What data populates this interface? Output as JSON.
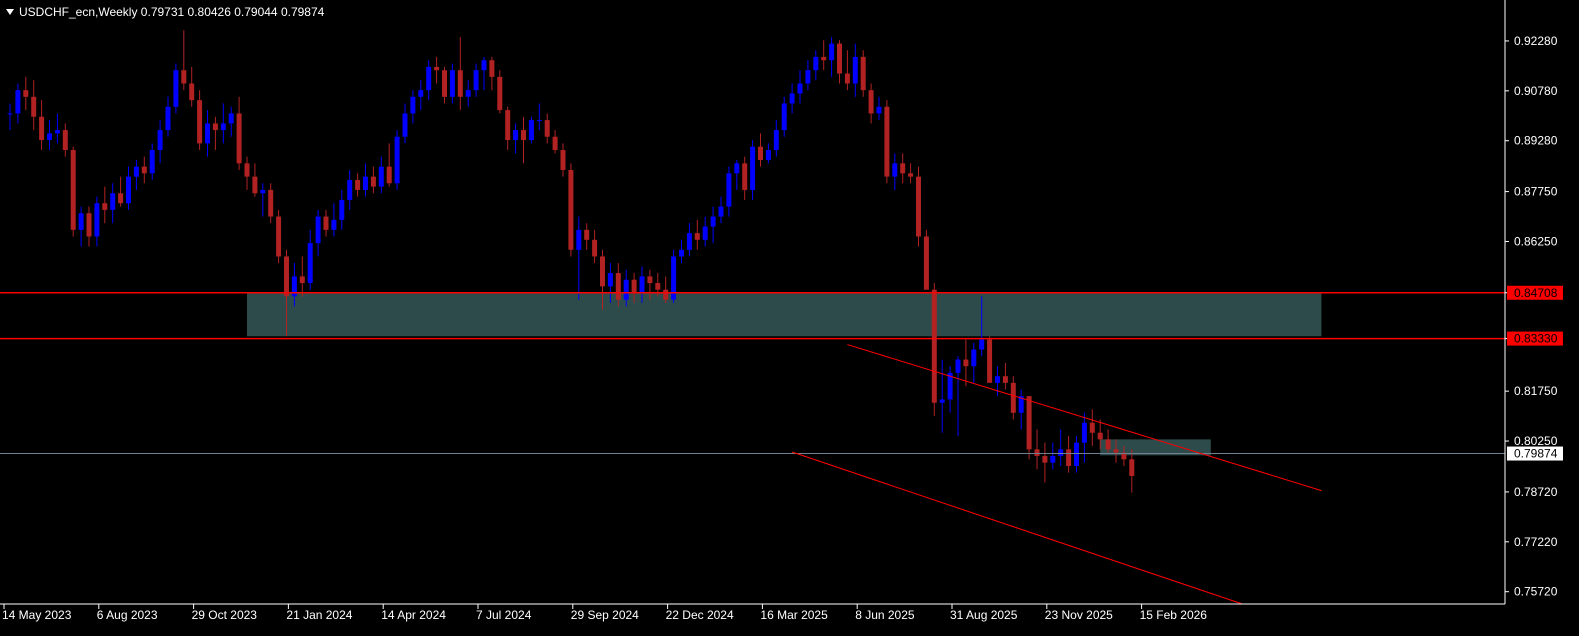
{
  "header": {
    "symbol": "USDCHF_ecn",
    "timeframe": "Weekly",
    "ohlc": "0.79731 0.80426 0.79044 0.79874",
    "title_text": "USDCHF_ecn,Weekly  0.79731 0.80426 0.79044 0.79874"
  },
  "colors": {
    "background": "#000000",
    "bull_candle": "#0000ff",
    "bear_candle": "#b22222",
    "zone_fill": "#2f4f4f",
    "level_line": "#ff0000",
    "channel_line": "#ff0000",
    "axis": "#ffffff",
    "price_line": "#708090"
  },
  "chart_data": {
    "type": "candlestick",
    "symbol": "USDCHF_ecn",
    "timeframe": "Weekly",
    "y_ticks": [
      "0.92280",
      "0.90780",
      "0.89280",
      "0.87750",
      "0.86250",
      "0.84708",
      "0.83330",
      "0.81750",
      "0.80250",
      "0.78720",
      "0.77220",
      "0.75720"
    ],
    "y_tick_values": [
      0.9228,
      0.9078,
      0.8928,
      0.8775,
      0.8625,
      0.84708,
      0.8333,
      0.8175,
      0.8025,
      0.7872,
      0.7722,
      0.7572
    ],
    "x_ticks": [
      "14 May 2023",
      "6 Aug 2023",
      "29 Oct 2023",
      "21 Jan 2024",
      "14 Apr 2024",
      "7 Jul 2024",
      "29 Sep 2024",
      "22 Dec 2024",
      "16 Mar 2025",
      "8 Jun 2025",
      "31 Aug 2025",
      "23 Nov 2025",
      "15 Feb 2026"
    ],
    "x_tick_index": [
      0,
      12,
      24,
      36,
      48,
      60,
      72,
      84,
      96,
      108,
      120,
      132,
      144
    ],
    "ylim": [
      0.7535,
      0.9315
    ],
    "current_price": "0.79874",
    "current_price_value": 0.79874,
    "horizontal_levels": [
      {
        "value": 0.84708,
        "label": "0.84708"
      },
      {
        "value": 0.8333,
        "label": "0.83330"
      }
    ],
    "zones": [
      {
        "from_index": 30,
        "to_index": 166,
        "top": 0.847,
        "bottom": 0.834
      },
      {
        "from_index": 138,
        "to_index": 152,
        "top": 0.803,
        "bottom": 0.7982
      }
    ],
    "channel": {
      "upper": {
        "from_index": 106,
        "from_price": 0.8315,
        "to_index": 166,
        "to_price": 0.7876
      },
      "lower": {
        "from_index": 99,
        "from_price": 0.7992,
        "to_index": 156,
        "to_price": 0.7535
      }
    },
    "candles": [
      {
        "o": 0.901,
        "h": 0.904,
        "l": 0.896,
        "c": 0.901
      },
      {
        "o": 0.901,
        "h": 0.91,
        "l": 0.898,
        "c": 0.908
      },
      {
        "o": 0.908,
        "h": 0.912,
        "l": 0.902,
        "c": 0.906
      },
      {
        "o": 0.906,
        "h": 0.911,
        "l": 0.896,
        "c": 0.9
      },
      {
        "o": 0.9,
        "h": 0.905,
        "l": 0.89,
        "c": 0.893
      },
      {
        "o": 0.893,
        "h": 0.899,
        "l": 0.89,
        "c": 0.895
      },
      {
        "o": 0.895,
        "h": 0.901,
        "l": 0.892,
        "c": 0.896
      },
      {
        "o": 0.896,
        "h": 0.898,
        "l": 0.888,
        "c": 0.89
      },
      {
        "o": 0.89,
        "h": 0.891,
        "l": 0.864,
        "c": 0.866
      },
      {
        "o": 0.866,
        "h": 0.873,
        "l": 0.861,
        "c": 0.871
      },
      {
        "o": 0.871,
        "h": 0.873,
        "l": 0.861,
        "c": 0.864
      },
      {
        "o": 0.864,
        "h": 0.876,
        "l": 0.861,
        "c": 0.874
      },
      {
        "o": 0.874,
        "h": 0.879,
        "l": 0.868,
        "c": 0.872
      },
      {
        "o": 0.872,
        "h": 0.88,
        "l": 0.868,
        "c": 0.877
      },
      {
        "o": 0.877,
        "h": 0.882,
        "l": 0.873,
        "c": 0.874
      },
      {
        "o": 0.874,
        "h": 0.885,
        "l": 0.872,
        "c": 0.882
      },
      {
        "o": 0.882,
        "h": 0.887,
        "l": 0.878,
        "c": 0.885
      },
      {
        "o": 0.885,
        "h": 0.888,
        "l": 0.88,
        "c": 0.883
      },
      {
        "o": 0.883,
        "h": 0.892,
        "l": 0.881,
        "c": 0.89
      },
      {
        "o": 0.89,
        "h": 0.899,
        "l": 0.886,
        "c": 0.896
      },
      {
        "o": 0.896,
        "h": 0.906,
        "l": 0.894,
        "c": 0.903
      },
      {
        "o": 0.903,
        "h": 0.916,
        "l": 0.901,
        "c": 0.914
      },
      {
        "o": 0.914,
        "h": 0.926,
        "l": 0.908,
        "c": 0.91
      },
      {
        "o": 0.91,
        "h": 0.915,
        "l": 0.903,
        "c": 0.905
      },
      {
        "o": 0.905,
        "h": 0.908,
        "l": 0.89,
        "c": 0.892
      },
      {
        "o": 0.892,
        "h": 0.902,
        "l": 0.888,
        "c": 0.898
      },
      {
        "o": 0.898,
        "h": 0.9,
        "l": 0.89,
        "c": 0.896
      },
      {
        "o": 0.896,
        "h": 0.904,
        "l": 0.892,
        "c": 0.898
      },
      {
        "o": 0.898,
        "h": 0.903,
        "l": 0.894,
        "c": 0.901
      },
      {
        "o": 0.901,
        "h": 0.906,
        "l": 0.884,
        "c": 0.886
      },
      {
        "o": 0.886,
        "h": 0.888,
        "l": 0.878,
        "c": 0.882
      },
      {
        "o": 0.882,
        "h": 0.886,
        "l": 0.876,
        "c": 0.877
      },
      {
        "o": 0.877,
        "h": 0.88,
        "l": 0.87,
        "c": 0.878
      },
      {
        "o": 0.878,
        "h": 0.88,
        "l": 0.868,
        "c": 0.87
      },
      {
        "o": 0.87,
        "h": 0.872,
        "l": 0.856,
        "c": 0.858
      },
      {
        "o": 0.858,
        "h": 0.86,
        "l": 0.834,
        "c": 0.846
      },
      {
        "o": 0.846,
        "h": 0.856,
        "l": 0.843,
        "c": 0.852
      },
      {
        "o": 0.852,
        "h": 0.858,
        "l": 0.846,
        "c": 0.85
      },
      {
        "o": 0.85,
        "h": 0.866,
        "l": 0.848,
        "c": 0.862
      },
      {
        "o": 0.862,
        "h": 0.872,
        "l": 0.858,
        "c": 0.87
      },
      {
        "o": 0.87,
        "h": 0.872,
        "l": 0.864,
        "c": 0.866
      },
      {
        "o": 0.866,
        "h": 0.874,
        "l": 0.864,
        "c": 0.869
      },
      {
        "o": 0.869,
        "h": 0.878,
        "l": 0.866,
        "c": 0.875
      },
      {
        "o": 0.875,
        "h": 0.884,
        "l": 0.872,
        "c": 0.881
      },
      {
        "o": 0.881,
        "h": 0.883,
        "l": 0.876,
        "c": 0.878
      },
      {
        "o": 0.878,
        "h": 0.886,
        "l": 0.876,
        "c": 0.882
      },
      {
        "o": 0.882,
        "h": 0.885,
        "l": 0.877,
        "c": 0.879
      },
      {
        "o": 0.879,
        "h": 0.888,
        "l": 0.877,
        "c": 0.885
      },
      {
        "o": 0.885,
        "h": 0.892,
        "l": 0.879,
        "c": 0.88
      },
      {
        "o": 0.88,
        "h": 0.896,
        "l": 0.878,
        "c": 0.894
      },
      {
        "o": 0.894,
        "h": 0.904,
        "l": 0.892,
        "c": 0.901
      },
      {
        "o": 0.901,
        "h": 0.908,
        "l": 0.898,
        "c": 0.906
      },
      {
        "o": 0.906,
        "h": 0.911,
        "l": 0.902,
        "c": 0.908
      },
      {
        "o": 0.908,
        "h": 0.917,
        "l": 0.905,
        "c": 0.915
      },
      {
        "o": 0.915,
        "h": 0.918,
        "l": 0.91,
        "c": 0.914
      },
      {
        "o": 0.914,
        "h": 0.915,
        "l": 0.904,
        "c": 0.906
      },
      {
        "o": 0.906,
        "h": 0.916,
        "l": 0.904,
        "c": 0.914
      },
      {
        "o": 0.914,
        "h": 0.924,
        "l": 0.902,
        "c": 0.906
      },
      {
        "o": 0.906,
        "h": 0.911,
        "l": 0.903,
        "c": 0.908
      },
      {
        "o": 0.908,
        "h": 0.916,
        "l": 0.906,
        "c": 0.914
      },
      {
        "o": 0.914,
        "h": 0.918,
        "l": 0.908,
        "c": 0.917
      },
      {
        "o": 0.917,
        "h": 0.918,
        "l": 0.908,
        "c": 0.912
      },
      {
        "o": 0.912,
        "h": 0.914,
        "l": 0.901,
        "c": 0.902
      },
      {
        "o": 0.902,
        "h": 0.903,
        "l": 0.89,
        "c": 0.893
      },
      {
        "o": 0.893,
        "h": 0.898,
        "l": 0.889,
        "c": 0.896
      },
      {
        "o": 0.896,
        "h": 0.9,
        "l": 0.886,
        "c": 0.893
      },
      {
        "o": 0.893,
        "h": 0.9,
        "l": 0.892,
        "c": 0.899
      },
      {
        "o": 0.899,
        "h": 0.904,
        "l": 0.896,
        "c": 0.899
      },
      {
        "o": 0.899,
        "h": 0.901,
        "l": 0.892,
        "c": 0.894
      },
      {
        "o": 0.894,
        "h": 0.896,
        "l": 0.889,
        "c": 0.89
      },
      {
        "o": 0.89,
        "h": 0.892,
        "l": 0.882,
        "c": 0.884
      },
      {
        "o": 0.884,
        "h": 0.886,
        "l": 0.858,
        "c": 0.86
      },
      {
        "o": 0.86,
        "h": 0.87,
        "l": 0.845,
        "c": 0.866
      },
      {
        "o": 0.866,
        "h": 0.868,
        "l": 0.86,
        "c": 0.863
      },
      {
        "o": 0.863,
        "h": 0.866,
        "l": 0.856,
        "c": 0.858
      },
      {
        "o": 0.858,
        "h": 0.86,
        "l": 0.842,
        "c": 0.849
      },
      {
        "o": 0.849,
        "h": 0.856,
        "l": 0.844,
        "c": 0.853
      },
      {
        "o": 0.853,
        "h": 0.856,
        "l": 0.843,
        "c": 0.845
      },
      {
        "o": 0.845,
        "h": 0.854,
        "l": 0.843,
        "c": 0.851
      },
      {
        "o": 0.851,
        "h": 0.853,
        "l": 0.844,
        "c": 0.847
      },
      {
        "o": 0.847,
        "h": 0.855,
        "l": 0.844,
        "c": 0.852
      },
      {
        "o": 0.852,
        "h": 0.854,
        "l": 0.845,
        "c": 0.85
      },
      {
        "o": 0.85,
        "h": 0.853,
        "l": 0.846,
        "c": 0.848
      },
      {
        "o": 0.848,
        "h": 0.852,
        "l": 0.844,
        "c": 0.845
      },
      {
        "o": 0.845,
        "h": 0.86,
        "l": 0.844,
        "c": 0.858
      },
      {
        "o": 0.858,
        "h": 0.863,
        "l": 0.856,
        "c": 0.86
      },
      {
        "o": 0.86,
        "h": 0.868,
        "l": 0.858,
        "c": 0.865
      },
      {
        "o": 0.865,
        "h": 0.869,
        "l": 0.86,
        "c": 0.863
      },
      {
        "o": 0.863,
        "h": 0.87,
        "l": 0.861,
        "c": 0.867
      },
      {
        "o": 0.867,
        "h": 0.873,
        "l": 0.862,
        "c": 0.87
      },
      {
        "o": 0.87,
        "h": 0.876,
        "l": 0.868,
        "c": 0.873
      },
      {
        "o": 0.873,
        "h": 0.885,
        "l": 0.87,
        "c": 0.883
      },
      {
        "o": 0.883,
        "h": 0.887,
        "l": 0.878,
        "c": 0.886
      },
      {
        "o": 0.886,
        "h": 0.888,
        "l": 0.875,
        "c": 0.878
      },
      {
        "o": 0.878,
        "h": 0.893,
        "l": 0.875,
        "c": 0.891
      },
      {
        "o": 0.891,
        "h": 0.895,
        "l": 0.885,
        "c": 0.887
      },
      {
        "o": 0.887,
        "h": 0.892,
        "l": 0.886,
        "c": 0.89
      },
      {
        "o": 0.89,
        "h": 0.899,
        "l": 0.888,
        "c": 0.896
      },
      {
        "o": 0.896,
        "h": 0.906,
        "l": 0.894,
        "c": 0.904
      },
      {
        "o": 0.904,
        "h": 0.91,
        "l": 0.901,
        "c": 0.907
      },
      {
        "o": 0.907,
        "h": 0.914,
        "l": 0.904,
        "c": 0.91
      },
      {
        "o": 0.91,
        "h": 0.917,
        "l": 0.908,
        "c": 0.914
      },
      {
        "o": 0.914,
        "h": 0.92,
        "l": 0.911,
        "c": 0.918
      },
      {
        "o": 0.918,
        "h": 0.923,
        "l": 0.914,
        "c": 0.917
      },
      {
        "o": 0.917,
        "h": 0.924,
        "l": 0.912,
        "c": 0.922
      },
      {
        "o": 0.922,
        "h": 0.923,
        "l": 0.91,
        "c": 0.913
      },
      {
        "o": 0.913,
        "h": 0.92,
        "l": 0.908,
        "c": 0.91
      },
      {
        "o": 0.91,
        "h": 0.922,
        "l": 0.906,
        "c": 0.918
      },
      {
        "o": 0.918,
        "h": 0.92,
        "l": 0.906,
        "c": 0.908
      },
      {
        "o": 0.908,
        "h": 0.91,
        "l": 0.898,
        "c": 0.901
      },
      {
        "o": 0.901,
        "h": 0.906,
        "l": 0.899,
        "c": 0.903
      },
      {
        "o": 0.903,
        "h": 0.905,
        "l": 0.88,
        "c": 0.882
      },
      {
        "o": 0.882,
        "h": 0.889,
        "l": 0.878,
        "c": 0.886
      },
      {
        "o": 0.886,
        "h": 0.889,
        "l": 0.88,
        "c": 0.883
      },
      {
        "o": 0.883,
        "h": 0.886,
        "l": 0.88,
        "c": 0.882
      },
      {
        "o": 0.882,
        "h": 0.885,
        "l": 0.861,
        "c": 0.864
      },
      {
        "o": 0.864,
        "h": 0.866,
        "l": 0.85,
        "c": 0.848
      },
      {
        "o": 0.848,
        "h": 0.85,
        "l": 0.81,
        "c": 0.814
      },
      {
        "o": 0.814,
        "h": 0.827,
        "l": 0.805,
        "c": 0.815
      },
      {
        "o": 0.815,
        "h": 0.825,
        "l": 0.811,
        "c": 0.823
      },
      {
        "o": 0.823,
        "h": 0.828,
        "l": 0.804,
        "c": 0.827
      },
      {
        "o": 0.827,
        "h": 0.833,
        "l": 0.819,
        "c": 0.825
      },
      {
        "o": 0.825,
        "h": 0.832,
        "l": 0.82,
        "c": 0.83
      },
      {
        "o": 0.83,
        "h": 0.846,
        "l": 0.828,
        "c": 0.833
      },
      {
        "o": 0.833,
        "h": 0.834,
        "l": 0.82,
        "c": 0.82
      },
      {
        "o": 0.82,
        "h": 0.825,
        "l": 0.816,
        "c": 0.822
      },
      {
        "o": 0.822,
        "h": 0.826,
        "l": 0.818,
        "c": 0.82
      },
      {
        "o": 0.82,
        "h": 0.822,
        "l": 0.809,
        "c": 0.811
      },
      {
        "o": 0.811,
        "h": 0.818,
        "l": 0.806,
        "c": 0.816
      },
      {
        "o": 0.816,
        "h": 0.816,
        "l": 0.797,
        "c": 0.8
      },
      {
        "o": 0.8,
        "h": 0.806,
        "l": 0.794,
        "c": 0.798
      },
      {
        "o": 0.798,
        "h": 0.802,
        "l": 0.79,
        "c": 0.796
      },
      {
        "o": 0.796,
        "h": 0.802,
        "l": 0.794,
        "c": 0.798
      },
      {
        "o": 0.798,
        "h": 0.806,
        "l": 0.795,
        "c": 0.8
      },
      {
        "o": 0.8,
        "h": 0.804,
        "l": 0.793,
        "c": 0.795
      },
      {
        "o": 0.795,
        "h": 0.804,
        "l": 0.793,
        "c": 0.802
      },
      {
        "o": 0.802,
        "h": 0.811,
        "l": 0.796,
        "c": 0.808
      },
      {
        "o": 0.808,
        "h": 0.812,
        "l": 0.801,
        "c": 0.805
      },
      {
        "o": 0.805,
        "h": 0.809,
        "l": 0.8,
        "c": 0.803
      },
      {
        "o": 0.803,
        "h": 0.806,
        "l": 0.799,
        "c": 0.8
      },
      {
        "o": 0.8,
        "h": 0.803,
        "l": 0.796,
        "c": 0.799
      },
      {
        "o": 0.799,
        "h": 0.801,
        "l": 0.795,
        "c": 0.797
      },
      {
        "o": 0.797,
        "h": 0.8,
        "l": 0.787,
        "c": 0.792
      }
    ]
  }
}
